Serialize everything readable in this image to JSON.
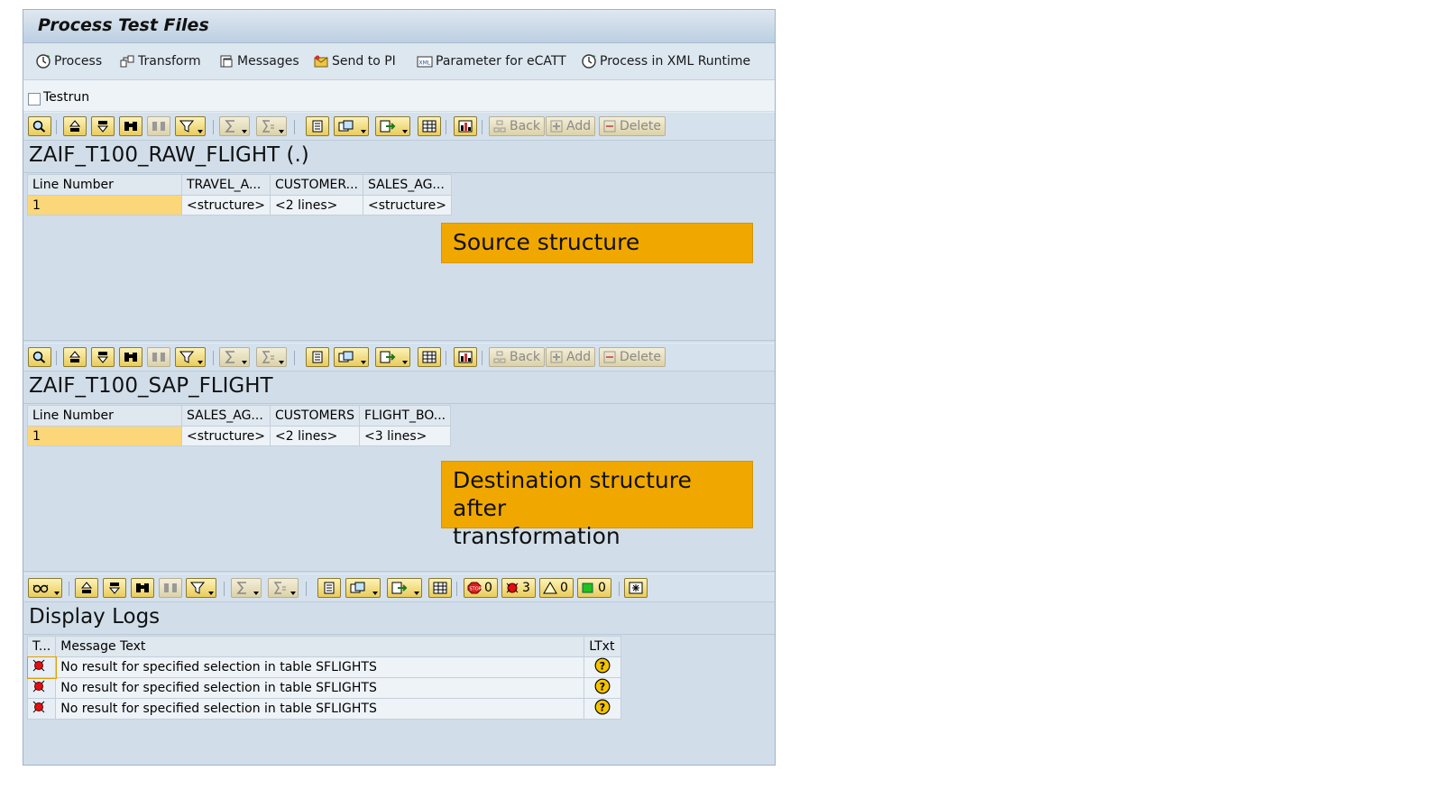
{
  "window": {
    "title": "Process Test Files"
  },
  "appbar": {
    "buttons": [
      {
        "label": "Process",
        "icon": "process-icon"
      },
      {
        "label": "Transform",
        "icon": "transform-icon"
      },
      {
        "label": "Messages",
        "icon": "messages-icon"
      },
      {
        "label": "Send to PI",
        "icon": "send-icon"
      },
      {
        "label": "Parameter for eCATT",
        "icon": "xml-icon"
      },
      {
        "label": "Process in XML Runtime",
        "icon": "process-icon"
      }
    ]
  },
  "testrun": {
    "label": "Testrun",
    "checked": false
  },
  "toolbar": {
    "back": "Back",
    "add": "Add",
    "delete": "Delete"
  },
  "source": {
    "title": "ZAIF_T100_RAW_FLIGHT (.)",
    "columns": [
      "Line Number",
      "TRAVEL_A...",
      "CUSTOMER...",
      "SALES_AG..."
    ],
    "rows": [
      [
        "1",
        "<structure>",
        "<2 lines>",
        "<structure>"
      ]
    ],
    "callout": "Source structure"
  },
  "destination": {
    "title": "ZAIF_T100_SAP_FLIGHT",
    "columns": [
      "Line Number",
      "SALES_AG...",
      "CUSTOMERS",
      "FLIGHT_BO..."
    ],
    "rows": [
      [
        "1",
        "<structure>",
        "<2 lines>",
        "<3 lines>"
      ]
    ],
    "callout_line1": "Destination structure after",
    "callout_line2": "transformation"
  },
  "logs": {
    "title": "Display Logs",
    "counts": {
      "stop": "0",
      "error": "3",
      "warning": "0",
      "success": "0"
    },
    "columns": [
      "T...",
      "Message Text",
      "LTxt"
    ],
    "rows": [
      {
        "type": "error-icon",
        "text": "No result for specified selection in table SFLIGHTS",
        "ltxt": "help-icon"
      },
      {
        "type": "error-icon",
        "text": "No result for specified selection in table SFLIGHTS",
        "ltxt": "help-icon"
      },
      {
        "type": "error-icon",
        "text": "No result for specified selection in table SFLIGHTS",
        "ltxt": "help-icon"
      }
    ]
  },
  "colors": {
    "accent": "#f0a800",
    "panel": "#d1deea",
    "header": "#bccfe1",
    "selected": "#fbd77a"
  }
}
